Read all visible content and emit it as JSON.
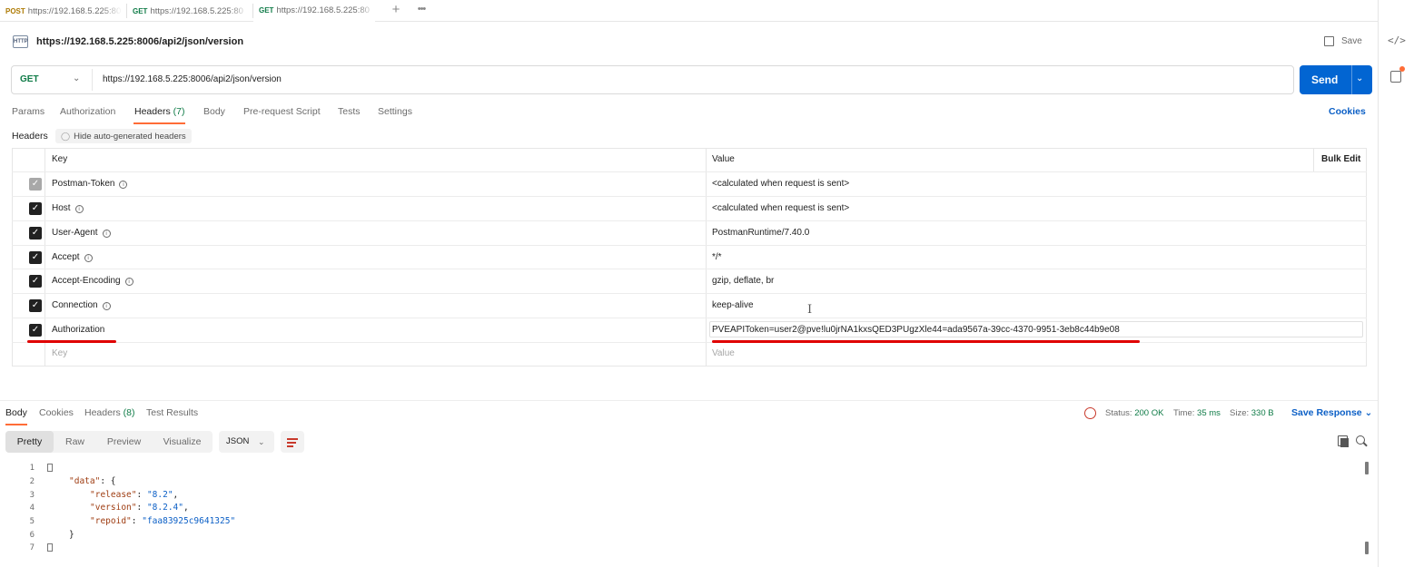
{
  "tabs": [
    {
      "method": "POST",
      "url": "https://192.168.5.225:80"
    },
    {
      "method": "GET",
      "url": "https://192.168.5.225:80"
    },
    {
      "method": "GET",
      "url": "https://192.168.5.225:80"
    }
  ],
  "tabstrip": {
    "new_tab": "+",
    "more": "•••"
  },
  "rail": {
    "code": "</>"
  },
  "request": {
    "icon_text": "HTTP",
    "title": "https://192.168.5.225:8006/api2/json/version",
    "save_label": "Save",
    "method": "GET",
    "url": "https://192.168.5.225:8006/api2/json/version",
    "send_label": "Send"
  },
  "request_tabs": {
    "params": "Params",
    "authorization": "Authorization",
    "headers": "Headers",
    "headers_count": "(7)",
    "body": "Body",
    "pre_request": "Pre-request Script",
    "tests": "Tests",
    "settings": "Settings",
    "cookies": "Cookies"
  },
  "headers_section": {
    "label": "Headers",
    "hide_auto": "Hide auto-generated headers",
    "col_key": "Key",
    "col_value": "Value",
    "bulk_edit": "Bulk Edit",
    "rows": [
      {
        "key": "Postman-Token",
        "value": "<calculated when request is sent>"
      },
      {
        "key": "Host",
        "value": "<calculated when request is sent>"
      },
      {
        "key": "User-Agent",
        "value": "PostmanRuntime/7.40.0"
      },
      {
        "key": "Accept",
        "value": "*/*"
      },
      {
        "key": "Accept-Encoding",
        "value": "gzip, deflate, br"
      },
      {
        "key": "Connection",
        "value": "keep-alive"
      },
      {
        "key": "Authorization",
        "value": "PVEAPIToken=user2@pve!lu0jrNA1kxsQED3PUgzXle44=ada9567a-39cc-4370-9951-3eb8c44b9e08"
      }
    ],
    "placeholder_key": "Key",
    "placeholder_value": "Value"
  },
  "response": {
    "tabs": {
      "body": "Body",
      "cookies": "Cookies",
      "headers": "Headers",
      "headers_count": "(8)",
      "test_results": "Test Results"
    },
    "status_label": "Status:",
    "status_value": "200 OK",
    "time_label": "Time:",
    "time_value": "35 ms",
    "size_label": "Size:",
    "size_value": "330 B",
    "save_response": "Save Response",
    "view_modes": [
      "Pretty",
      "Raw",
      "Preview",
      "Visualize"
    ],
    "format": "JSON"
  },
  "code": {
    "line_numbers": [
      "1",
      "2",
      "3",
      "4",
      "5",
      "6",
      "7"
    ],
    "data_key": "\"data\"",
    "release_key": "\"release\"",
    "release_val": "\"8.2\"",
    "version_key": "\"version\"",
    "version_val": "\"8.2.4\"",
    "repoid_key": "\"repoid\"",
    "repoid_val": "\"faa83925c9641325\""
  },
  "colors": {
    "accent": "#ff6c37",
    "send": "#0265d2",
    "link": "#0b5fc6",
    "ok": "#0f7b47",
    "annotation": "#e00000"
  }
}
